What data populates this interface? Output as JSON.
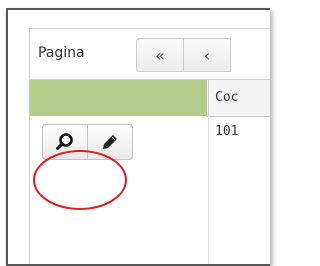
{
  "pager": {
    "label": "Pagina",
    "first_symbol": "«",
    "prev_symbol": "‹"
  },
  "grid": {
    "column_header": "Coc",
    "row_value": "101"
  },
  "icons": {
    "view": "magnifier-icon",
    "edit": "pencil-icon"
  },
  "colors": {
    "header_accent": "#b3cc8c",
    "highlight": "#e21b23"
  }
}
